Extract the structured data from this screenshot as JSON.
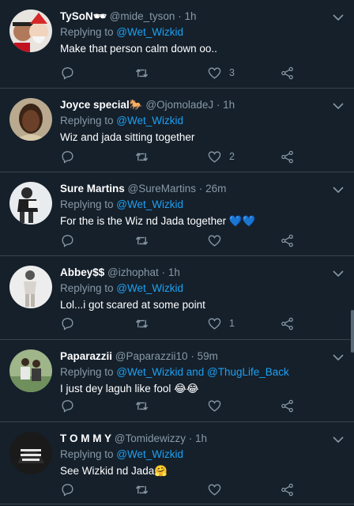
{
  "icons": {
    "reply": "reply-icon",
    "retweet": "retweet-icon",
    "like": "heart-icon",
    "share": "share-icon",
    "more": "chevron-down-icon"
  },
  "colors": {
    "background": "#15202b",
    "divider": "#38444d",
    "muted": "#8899a6",
    "mention": "#1da1f2",
    "text": "#ffffff"
  },
  "tweets": [
    {
      "name": "TySoN🕶",
      "handle": "@mide_tyson",
      "dot": "·",
      "time": "1h",
      "reply_prefix": "Replying to ",
      "mentions": [
        "@Wet_Wizkid"
      ],
      "reply_joiner": "",
      "text": "Make that person calm down oo..",
      "like_count": "3"
    },
    {
      "name": "Joyce special🐎",
      "handle": "@OjomoladeJ",
      "dot": "·",
      "time": "1h",
      "reply_prefix": "Replying to ",
      "mentions": [
        "@Wet_Wizkid"
      ],
      "reply_joiner": "",
      "text": "Wiz and jada sitting together",
      "like_count": "2"
    },
    {
      "name": "Sure Martins",
      "handle": "@SureMartins",
      "dot": "·",
      "time": "26m",
      "reply_prefix": "Replying to ",
      "mentions": [
        "@Wet_Wizkid"
      ],
      "reply_joiner": "",
      "text": "For the is the Wiz nd Jada  together 💙💙",
      "like_count": ""
    },
    {
      "name": "Abbey$$",
      "handle": "@izhophat",
      "dot": "·",
      "time": "1h",
      "reply_prefix": "Replying to ",
      "mentions": [
        "@Wet_Wizkid"
      ],
      "reply_joiner": "",
      "text": "Lol...i got scared at some point",
      "like_count": "1"
    },
    {
      "name": "Paparazzii",
      "handle": "@Paparazzii10",
      "dot": "·",
      "time": "59m",
      "reply_prefix": "Replying to ",
      "mentions": [
        "@Wet_Wizkid",
        "@ThugLife_Back"
      ],
      "reply_joiner": " and ",
      "text": "I just dey laguh like fool 😂😂",
      "like_count": ""
    },
    {
      "name": "T O M M Y",
      "handle": "@Tomidewizzy",
      "dot": "·",
      "time": "1h",
      "reply_prefix": "Replying to ",
      "mentions": [
        "@Wet_Wizkid"
      ],
      "reply_joiner": "",
      "text": "See Wizkid nd Jada🤗",
      "like_count": ""
    }
  ]
}
